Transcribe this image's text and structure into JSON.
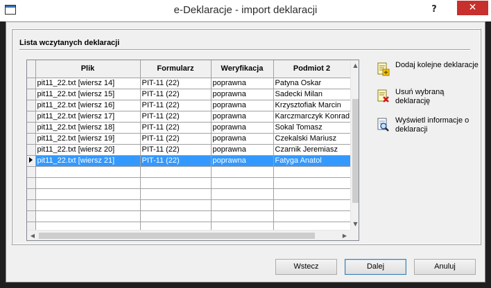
{
  "window": {
    "title": "e-Deklaracje - import deklaracji",
    "help_label": "?",
    "close_label": "✕"
  },
  "group": {
    "title": "Lista wczytanych deklaracji"
  },
  "table": {
    "columns": [
      "Plik",
      "Formularz",
      "Weryfikacja",
      "Podmiot 2"
    ],
    "rows": [
      [
        "pit11_22.txt [wiersz 14]",
        "PIT-11 (22)",
        "poprawna",
        "Patyna Oskar"
      ],
      [
        "pit11_22.txt [wiersz 15]",
        "PIT-11 (22)",
        "poprawna",
        "Sadecki Milan"
      ],
      [
        "pit11_22.txt [wiersz 16]",
        "PIT-11 (22)",
        "poprawna",
        "Krzysztofiak Marcin"
      ],
      [
        "pit11_22.txt [wiersz 17]",
        "PIT-11 (22)",
        "poprawna",
        "Karczmarczyk Konrad"
      ],
      [
        "pit11_22.txt [wiersz 18]",
        "PIT-11 (22)",
        "poprawna",
        "Sokal Tomasz"
      ],
      [
        "pit11_22.txt [wiersz 19]",
        "PIT-11 (22)",
        "poprawna",
        "Czekalski Mariusz"
      ],
      [
        "pit11_22.txt [wiersz 20]",
        "PIT-11 (22)",
        "poprawna",
        "Czarnik Jeremiasz"
      ],
      [
        "pit11_22.txt [wiersz 21]",
        "PIT-11 (22)",
        "poprawna",
        "Fatyga Anatol"
      ]
    ],
    "selected_row": 7,
    "empty_rows": 6
  },
  "actions": {
    "add": "Dodaj kolejne deklaracje",
    "remove": "Usuń wybraną deklarację",
    "info": "Wyświetl informacje o deklaracji"
  },
  "buttons": {
    "back": "Wstecz",
    "next": "Dalej",
    "cancel": "Anuluj"
  },
  "icons": {
    "add": "document-add-icon",
    "remove": "document-delete-icon",
    "info": "document-search-icon"
  }
}
